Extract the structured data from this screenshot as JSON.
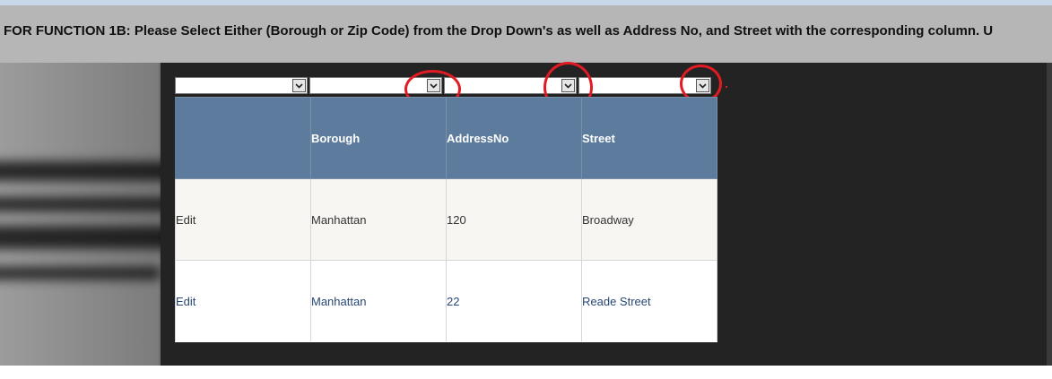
{
  "instruction": "FOR FUNCTION 1B: Please Select Either (Borough or Zip Code) from the Drop Down's as well as Address No, and Street with the corresponding column. U",
  "filters": [
    {
      "value": "",
      "icon": "chevron-down-icon",
      "highlighted": false
    },
    {
      "value": "",
      "icon": "chevron-down-icon",
      "highlighted": true
    },
    {
      "value": "",
      "icon": "chevron-down-icon",
      "highlighted": true
    },
    {
      "value": "",
      "icon": "chevron-down-icon",
      "highlighted": true
    }
  ],
  "table": {
    "headers": [
      "",
      "Borough",
      "AddressNo",
      "Street"
    ],
    "rows": [
      [
        "Edit",
        "Manhattan",
        "120",
        "Broadway"
      ],
      [
        "Edit",
        "Manhattan",
        "22",
        "Reade Street"
      ]
    ]
  },
  "colors": {
    "header_bg": "#5d7b9d",
    "header_text": "#ffffff",
    "row_alt_bg": "#f7f6f3",
    "row_text_dark": "#333333",
    "row_text_link": "#284775",
    "marker": "#e01b24"
  }
}
